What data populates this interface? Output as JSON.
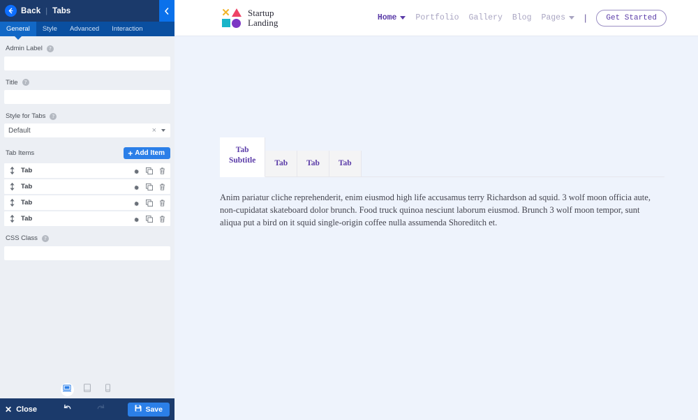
{
  "panel": {
    "header": {
      "back_label": "Back",
      "separator": "|",
      "title": "Tabs",
      "back_icon": "arrow-left-icon",
      "collapse_icon": "chevron-left-icon"
    },
    "tabs": [
      {
        "label": "General",
        "active": true
      },
      {
        "label": "Style",
        "active": false
      },
      {
        "label": "Advanced",
        "active": false
      },
      {
        "label": "Interaction",
        "active": false
      }
    ],
    "fields": {
      "admin_label": {
        "label": "Admin Label",
        "value": "",
        "placeholder": "",
        "help_icon": "question-mark-icon"
      },
      "title": {
        "label": "Title",
        "value": "",
        "placeholder": "",
        "help_icon": "question-mark-icon"
      },
      "style_for_tabs": {
        "label": "Style for Tabs",
        "value": "Default",
        "help_icon": "question-mark-icon",
        "clear_icon": "close-icon",
        "caret_icon": "chevron-down-icon"
      },
      "css_class": {
        "label": "CSS Class",
        "value": "",
        "placeholder": "",
        "help_icon": "question-mark-icon"
      }
    },
    "tab_items": {
      "title": "Tab Items",
      "add_label": "Add Item",
      "add_icon": "plus-icon",
      "rows": [
        {
          "label": "Tab",
          "drag_icon": "drag-handle-icon",
          "settings_icon": "gear-icon",
          "duplicate_icon": "duplicate-icon",
          "delete_icon": "trash-icon"
        },
        {
          "label": "Tab",
          "drag_icon": "drag-handle-icon",
          "settings_icon": "gear-icon",
          "duplicate_icon": "duplicate-icon",
          "delete_icon": "trash-icon"
        },
        {
          "label": "Tab",
          "drag_icon": "drag-handle-icon",
          "settings_icon": "gear-icon",
          "duplicate_icon": "duplicate-icon",
          "delete_icon": "trash-icon"
        },
        {
          "label": "Tab",
          "drag_icon": "drag-handle-icon",
          "settings_icon": "gear-icon",
          "duplicate_icon": "duplicate-icon",
          "delete_icon": "trash-icon"
        }
      ]
    },
    "devices": [
      {
        "name": "desktop",
        "icon": "desktop-icon",
        "active": true
      },
      {
        "name": "tablet",
        "icon": "tablet-icon",
        "active": false
      },
      {
        "name": "mobile",
        "icon": "mobile-icon",
        "active": false
      }
    ],
    "footer": {
      "close_label": "Close",
      "close_icon": "close-x-icon",
      "undo_icon": "undo-arrow-icon",
      "redo_icon": "redo-arrow-icon",
      "save_label": "Save",
      "save_icon": "floppy-disk-icon"
    },
    "colors": {
      "header_bg": "#1b3a6b",
      "tabbar_bg": "#0a4fa0",
      "accent_blue": "#2b7fe8",
      "collapse_blue": "#0a71eb",
      "panel_bg": "#eceff4"
    }
  },
  "site": {
    "logo": {
      "line1": "Startup",
      "line2": "Landing",
      "shapes": [
        {
          "name": "x-mark-icon",
          "color": "#f0b429"
        },
        {
          "name": "triangle-icon",
          "color": "#ee4266"
        },
        {
          "name": "square-icon",
          "color": "#19b5c9"
        },
        {
          "name": "circle-icon",
          "color": "#7b36c4"
        }
      ]
    },
    "nav": [
      {
        "label": "Home",
        "active": true,
        "caret": true
      },
      {
        "label": "Portfolio",
        "active": false,
        "caret": false
      },
      {
        "label": "Gallery",
        "active": false,
        "caret": false
      },
      {
        "label": "Blog",
        "active": false,
        "caret": false
      },
      {
        "label": "Pages",
        "active": false,
        "caret": true
      }
    ],
    "nav_divider": "|",
    "cta_label": "Get Started",
    "accent_color": "#5b3ca8"
  },
  "preview": {
    "tabs": [
      {
        "line1": "Tab",
        "line2": "Subtitle",
        "active": true
      },
      {
        "line1": "Tab",
        "line2": "",
        "active": false
      },
      {
        "line1": "Tab",
        "line2": "",
        "active": false
      },
      {
        "line1": "Tab",
        "line2": "",
        "active": false
      }
    ],
    "content": "Anim pariatur cliche reprehenderit, enim eiusmod high life accusamus terry Richardson ad squid. 3 wolf moon officia aute, non-cupidatat skateboard dolor brunch. Food truck quinoa nesciunt laborum eiusmod. Brunch 3 wolf moon tempor, sunt aliqua put a bird on it squid single-origin coffee nulla assumenda Shoreditch et."
  }
}
